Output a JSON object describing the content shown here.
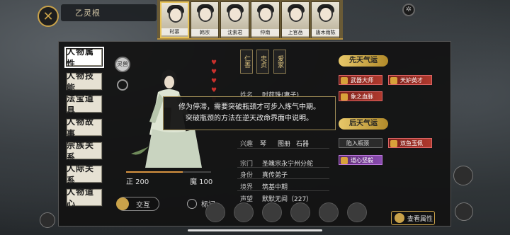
{
  "header": {
    "title": "乙灵根"
  },
  "portraits": [
    {
      "name": "时慕"
    },
    {
      "name": "韩宗"
    },
    {
      "name": "沈素君"
    },
    {
      "name": "仲南"
    },
    {
      "name": "上官岳"
    },
    {
      "name": "唐木雨陈"
    }
  ],
  "tabs": [
    {
      "label": "人物属性"
    },
    {
      "label": "人物技能"
    },
    {
      "label": "法宝道具"
    },
    {
      "label": "人物故事"
    },
    {
      "label": "宗族关系"
    },
    {
      "label": "人际关系"
    },
    {
      "label": "人物道心"
    }
  ],
  "traits": [
    {
      "label": "仁善"
    },
    {
      "label": "忠贞"
    },
    {
      "label": "爱家"
    }
  ],
  "info": {
    "name_label": "姓名",
    "name_value": "时茹珠(妻子)",
    "hobby_label": "兴趣",
    "hobby_1": "琴",
    "hobby_2": "图册",
    "hobby_3": "石器",
    "status_label": "陷入瓶颈",
    "sect_label": "宗门",
    "sect_value": "圣魄宗永宁州分舵",
    "identity_label": "身份",
    "identity_value": "真传弟子",
    "realm_label": "境界",
    "realm_value": "筑基中期",
    "fame_label": "声望",
    "fame_value": "默默无闻（227）"
  },
  "stats": {
    "zheng": "正 200",
    "mo": "魔 100",
    "zheng_fraction": 0.67
  },
  "tooltip": {
    "line1": "修为停滞，需要突破瓶颈才可步入炼气中期。",
    "line2": "突破瓶颈的方法在逆天改命界面中说明。"
  },
  "luck": {
    "innate_header": "先天气运",
    "acquired_header": "后天气运",
    "innate": [
      {
        "label": "武器大师",
        "style": "red"
      },
      {
        "label": "天妒英才",
        "style": "red"
      },
      {
        "label": "象之血脉",
        "style": "red"
      }
    ],
    "acquired": [
      {
        "label": "双鱼玉佩",
        "style": "red"
      },
      {
        "label": "道心坚毅",
        "style": "purple"
      }
    ]
  },
  "buttons": {
    "interact": "交互",
    "mark": "标记",
    "view_attr": "查看属性"
  },
  "seal_text": "灵兽",
  "colors": {
    "accent": "#c9a24a",
    "panel": "#121212"
  }
}
